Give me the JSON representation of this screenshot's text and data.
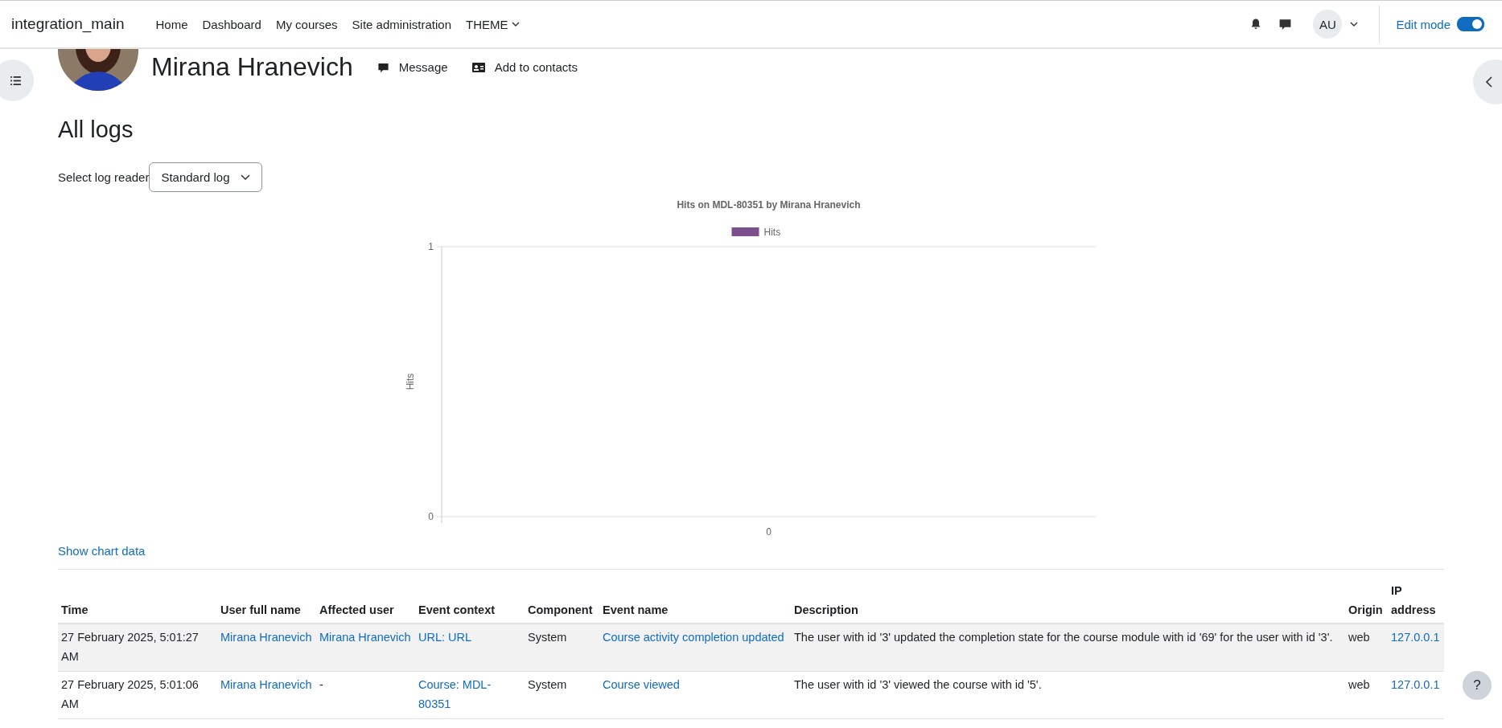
{
  "navbar": {
    "brand": "integration_main",
    "items": [
      {
        "label": "Home",
        "kind": "link"
      },
      {
        "label": "Dashboard",
        "kind": "link"
      },
      {
        "label": "My courses",
        "kind": "link"
      },
      {
        "label": "Site administration",
        "kind": "link"
      },
      {
        "label": "THEME",
        "kind": "dropdown"
      }
    ],
    "user_initials": "AU",
    "edit_mode": {
      "label": "Edit mode",
      "on": true
    }
  },
  "profile": {
    "name": "Mirana Hranevich",
    "actions": [
      {
        "label": "Message",
        "kind": "message"
      },
      {
        "label": "Add to contacts",
        "kind": "contact"
      }
    ]
  },
  "heading": "All logs",
  "log_reader": {
    "label": "Select log reader",
    "value": "Standard log"
  },
  "chart": {
    "chart_data": {
      "type": "bar",
      "title": "Hits on MDL-80351 by Mirana Hranevich",
      "ylabel": "Hits",
      "categories": [
        "0"
      ],
      "series": [
        {
          "name": "Hits",
          "color": "#7e4f8d",
          "values": [
            0
          ]
        }
      ],
      "ylim": [
        0,
        1
      ],
      "yticks": [
        0,
        1
      ]
    }
  },
  "show_chart_data": "Show chart data",
  "table": {
    "columns": [
      "Time",
      "User full name",
      "Affected user",
      "Event context",
      "Component",
      "Event name",
      "Description",
      "Origin",
      "IP address"
    ],
    "rows": [
      {
        "cells": [
          {
            "text": "27 February 2025, 5:01:27 AM",
            "link": false
          },
          {
            "text": "Mirana Hranevich",
            "link": true
          },
          {
            "text": "Mirana Hranevich",
            "link": true
          },
          {
            "text": "URL: URL",
            "link": true
          },
          {
            "text": "System",
            "link": false
          },
          {
            "text": "Course activity completion updated",
            "link": true
          },
          {
            "text": "The user with id '3' updated the completion state for the course module with id '69' for the user with id '3'.",
            "link": false
          },
          {
            "text": "web",
            "link": false
          },
          {
            "text": "127.0.0.1",
            "link": true
          }
        ]
      },
      {
        "cells": [
          {
            "text": "27 February 2025, 5:01:06 AM",
            "link": false
          },
          {
            "text": "Mirana Hranevich",
            "link": true
          },
          {
            "text": "-",
            "link": false
          },
          {
            "text": "Course: MDL-80351",
            "link": true
          },
          {
            "text": "System",
            "link": false
          },
          {
            "text": "Course viewed",
            "link": true
          },
          {
            "text": "The user with id '3' viewed the course with id '5'.",
            "link": false
          },
          {
            "text": "web",
            "link": false
          },
          {
            "text": "127.0.0.1",
            "link": true
          }
        ]
      }
    ]
  },
  "help_button": "?"
}
